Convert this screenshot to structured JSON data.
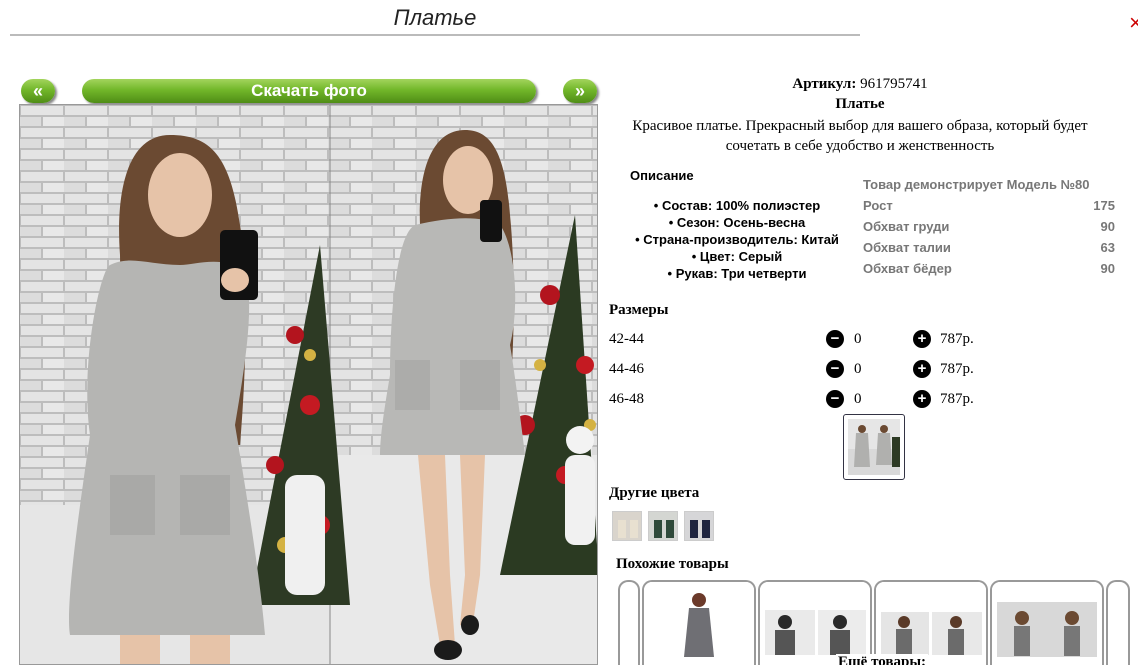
{
  "page": {
    "title": "Платье"
  },
  "nav": {
    "prev_label": "«",
    "next_label": "»",
    "download_label": "Скачать фото"
  },
  "product": {
    "article_label": "Артикул:",
    "article_value": "961795741",
    "name": "Платье",
    "description": "Красивое платье. Прекрасный выбор для вашего образа, который будет сочетать в себе удобство и женственность"
  },
  "details": {
    "title": "Описание",
    "items": [
      "Состав: 100% полиэстер",
      "Сезон: Осень-весна",
      "Страна-производитель: Китай",
      "Цвет: Серый",
      "Рукав: Три четверти"
    ]
  },
  "model": {
    "rows": [
      {
        "label": "Товар демонстрирует Модель №80",
        "value": ""
      },
      {
        "label": "Рост",
        "value": "175"
      },
      {
        "label": "Обхват груди",
        "value": "90"
      },
      {
        "label": "Обхват талии",
        "value": "63"
      },
      {
        "label": "Обхват бёдер",
        "value": "90"
      }
    ]
  },
  "sizes": {
    "title": "Размеры",
    "minus_icon": "−",
    "plus_icon": "+",
    "rows": [
      {
        "size": "42-44",
        "qty": "0",
        "price": "787р."
      },
      {
        "size": "44-46",
        "qty": "0",
        "price": "787р."
      },
      {
        "size": "46-48",
        "qty": "0",
        "price": "787р."
      }
    ]
  },
  "other_colors": {
    "title": "Другие цвета"
  },
  "similar": {
    "title": "Похожие товары",
    "more_label": "Ещё товары:"
  },
  "colors": {
    "button_green": "#72b72a",
    "dress_grey": "#b5b5b3",
    "brick": "#c9c9c9"
  }
}
